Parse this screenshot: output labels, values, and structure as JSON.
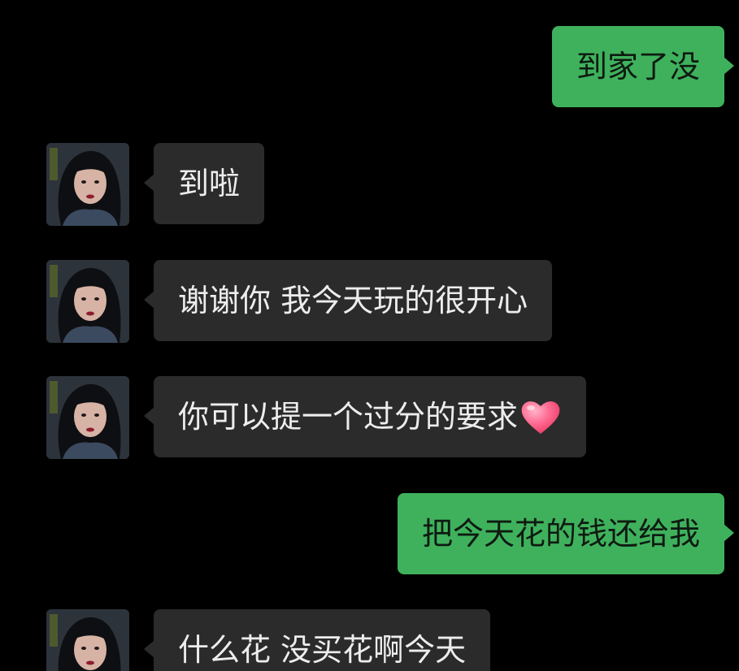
{
  "messages": [
    {
      "side": "out",
      "text": "到家了没"
    },
    {
      "side": "in",
      "text": "到啦"
    },
    {
      "side": "in",
      "text": "谢谢你 我今天玩的很开心"
    },
    {
      "side": "in",
      "text": "你可以提一个过分的要求",
      "emoji": "heart-emoji"
    },
    {
      "side": "out",
      "text": "把今天花的钱还给我"
    },
    {
      "side": "in",
      "text": "什么花 没买花啊今天"
    }
  ],
  "colors": {
    "background": "#000000",
    "incoming_bubble": "#2b2b2b",
    "outgoing_bubble": "#3fb15c",
    "heart": "#ff5f8a"
  }
}
